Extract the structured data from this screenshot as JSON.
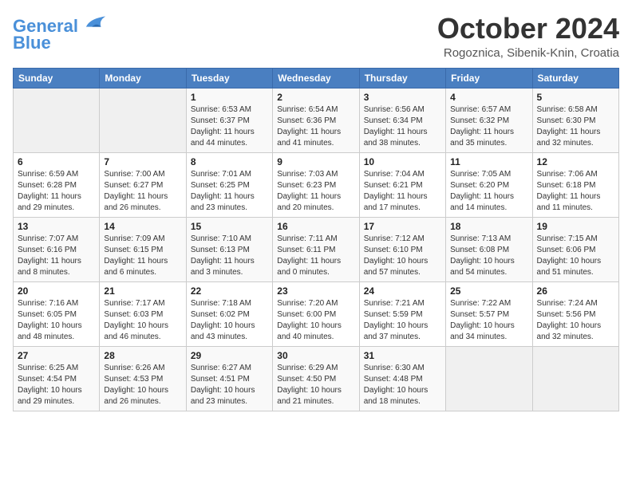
{
  "header": {
    "logo_line1": "General",
    "logo_line2": "Blue",
    "month_title": "October 2024",
    "location": "Rogoznica, Sibenik-Knin, Croatia"
  },
  "weekdays": [
    "Sunday",
    "Monday",
    "Tuesday",
    "Wednesday",
    "Thursday",
    "Friday",
    "Saturday"
  ],
  "weeks": [
    [
      {
        "day": "",
        "info": ""
      },
      {
        "day": "",
        "info": ""
      },
      {
        "day": "1",
        "info": "Sunrise: 6:53 AM\nSunset: 6:37 PM\nDaylight: 11 hours\nand 44 minutes."
      },
      {
        "day": "2",
        "info": "Sunrise: 6:54 AM\nSunset: 6:36 PM\nDaylight: 11 hours\nand 41 minutes."
      },
      {
        "day": "3",
        "info": "Sunrise: 6:56 AM\nSunset: 6:34 PM\nDaylight: 11 hours\nand 38 minutes."
      },
      {
        "day": "4",
        "info": "Sunrise: 6:57 AM\nSunset: 6:32 PM\nDaylight: 11 hours\nand 35 minutes."
      },
      {
        "day": "5",
        "info": "Sunrise: 6:58 AM\nSunset: 6:30 PM\nDaylight: 11 hours\nand 32 minutes."
      }
    ],
    [
      {
        "day": "6",
        "info": "Sunrise: 6:59 AM\nSunset: 6:28 PM\nDaylight: 11 hours\nand 29 minutes."
      },
      {
        "day": "7",
        "info": "Sunrise: 7:00 AM\nSunset: 6:27 PM\nDaylight: 11 hours\nand 26 minutes."
      },
      {
        "day": "8",
        "info": "Sunrise: 7:01 AM\nSunset: 6:25 PM\nDaylight: 11 hours\nand 23 minutes."
      },
      {
        "day": "9",
        "info": "Sunrise: 7:03 AM\nSunset: 6:23 PM\nDaylight: 11 hours\nand 20 minutes."
      },
      {
        "day": "10",
        "info": "Sunrise: 7:04 AM\nSunset: 6:21 PM\nDaylight: 11 hours\nand 17 minutes."
      },
      {
        "day": "11",
        "info": "Sunrise: 7:05 AM\nSunset: 6:20 PM\nDaylight: 11 hours\nand 14 minutes."
      },
      {
        "day": "12",
        "info": "Sunrise: 7:06 AM\nSunset: 6:18 PM\nDaylight: 11 hours\nand 11 minutes."
      }
    ],
    [
      {
        "day": "13",
        "info": "Sunrise: 7:07 AM\nSunset: 6:16 PM\nDaylight: 11 hours\nand 8 minutes."
      },
      {
        "day": "14",
        "info": "Sunrise: 7:09 AM\nSunset: 6:15 PM\nDaylight: 11 hours\nand 6 minutes."
      },
      {
        "day": "15",
        "info": "Sunrise: 7:10 AM\nSunset: 6:13 PM\nDaylight: 11 hours\nand 3 minutes."
      },
      {
        "day": "16",
        "info": "Sunrise: 7:11 AM\nSunset: 6:11 PM\nDaylight: 11 hours\nand 0 minutes."
      },
      {
        "day": "17",
        "info": "Sunrise: 7:12 AM\nSunset: 6:10 PM\nDaylight: 10 hours\nand 57 minutes."
      },
      {
        "day": "18",
        "info": "Sunrise: 7:13 AM\nSunset: 6:08 PM\nDaylight: 10 hours\nand 54 minutes."
      },
      {
        "day": "19",
        "info": "Sunrise: 7:15 AM\nSunset: 6:06 PM\nDaylight: 10 hours\nand 51 minutes."
      }
    ],
    [
      {
        "day": "20",
        "info": "Sunrise: 7:16 AM\nSunset: 6:05 PM\nDaylight: 10 hours\nand 48 minutes."
      },
      {
        "day": "21",
        "info": "Sunrise: 7:17 AM\nSunset: 6:03 PM\nDaylight: 10 hours\nand 46 minutes."
      },
      {
        "day": "22",
        "info": "Sunrise: 7:18 AM\nSunset: 6:02 PM\nDaylight: 10 hours\nand 43 minutes."
      },
      {
        "day": "23",
        "info": "Sunrise: 7:20 AM\nSunset: 6:00 PM\nDaylight: 10 hours\nand 40 minutes."
      },
      {
        "day": "24",
        "info": "Sunrise: 7:21 AM\nSunset: 5:59 PM\nDaylight: 10 hours\nand 37 minutes."
      },
      {
        "day": "25",
        "info": "Sunrise: 7:22 AM\nSunset: 5:57 PM\nDaylight: 10 hours\nand 34 minutes."
      },
      {
        "day": "26",
        "info": "Sunrise: 7:24 AM\nSunset: 5:56 PM\nDaylight: 10 hours\nand 32 minutes."
      }
    ],
    [
      {
        "day": "27",
        "info": "Sunrise: 6:25 AM\nSunset: 4:54 PM\nDaylight: 10 hours\nand 29 minutes."
      },
      {
        "day": "28",
        "info": "Sunrise: 6:26 AM\nSunset: 4:53 PM\nDaylight: 10 hours\nand 26 minutes."
      },
      {
        "day": "29",
        "info": "Sunrise: 6:27 AM\nSunset: 4:51 PM\nDaylight: 10 hours\nand 23 minutes."
      },
      {
        "day": "30",
        "info": "Sunrise: 6:29 AM\nSunset: 4:50 PM\nDaylight: 10 hours\nand 21 minutes."
      },
      {
        "day": "31",
        "info": "Sunrise: 6:30 AM\nSunset: 4:48 PM\nDaylight: 10 hours\nand 18 minutes."
      },
      {
        "day": "",
        "info": ""
      },
      {
        "day": "",
        "info": ""
      }
    ]
  ]
}
